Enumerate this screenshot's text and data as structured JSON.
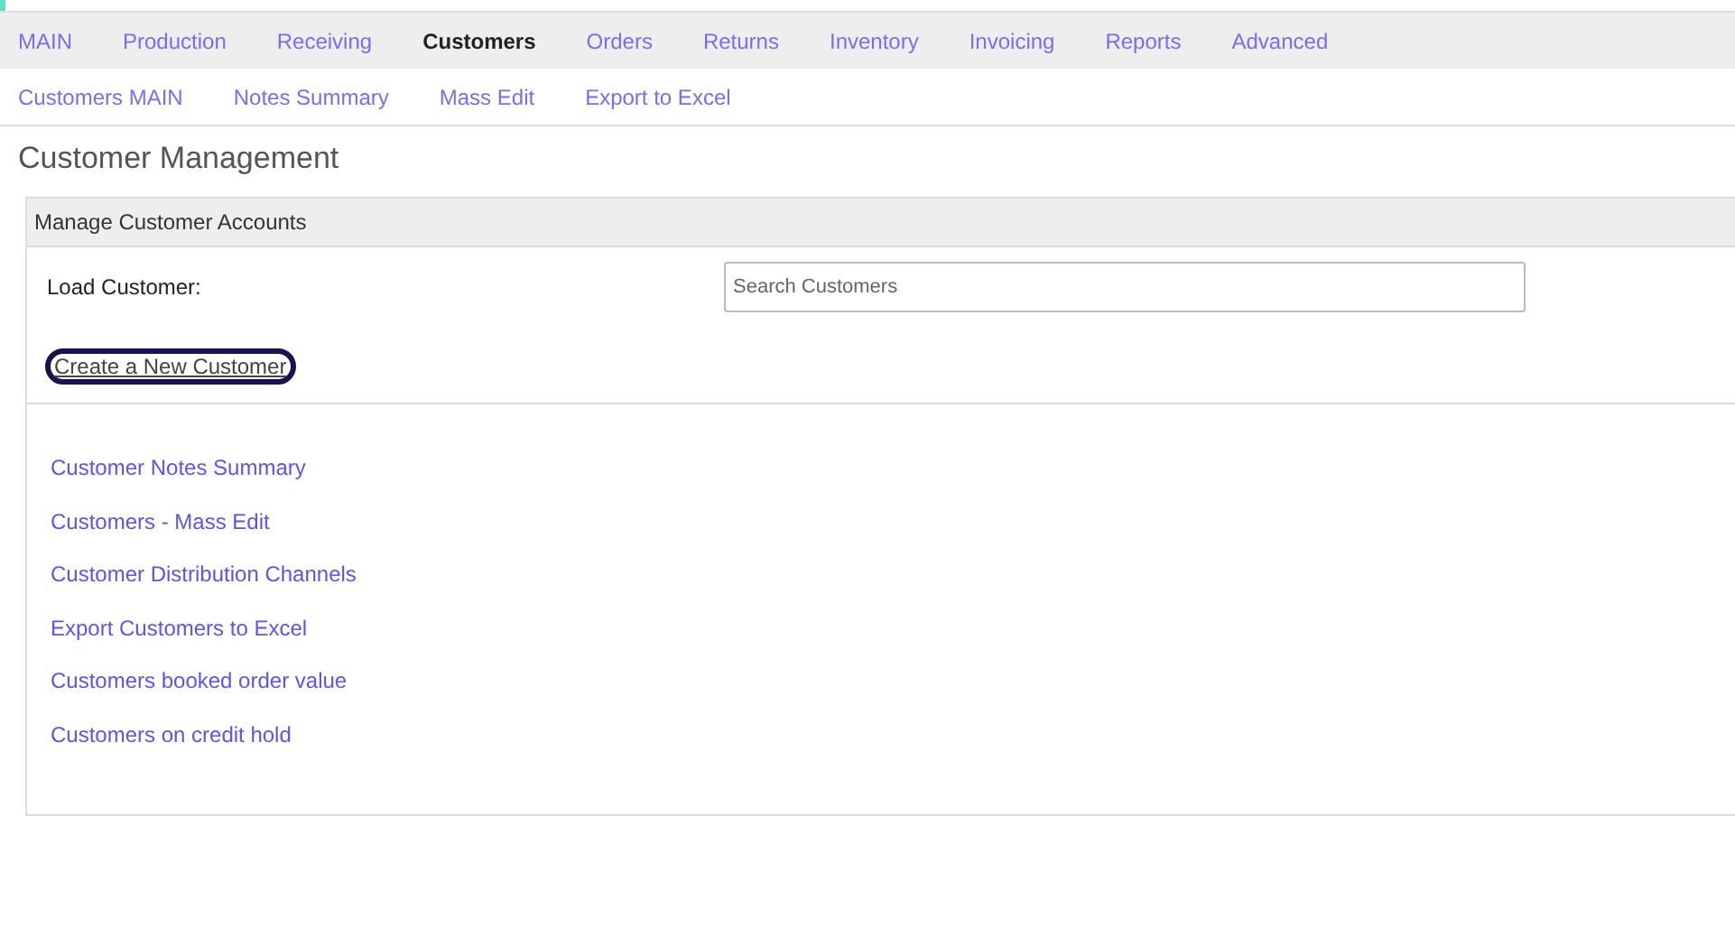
{
  "main_nav": [
    {
      "label": "MAIN",
      "selected": false
    },
    {
      "label": "Production",
      "selected": false
    },
    {
      "label": "Receiving",
      "selected": false
    },
    {
      "label": "Customers",
      "selected": true
    },
    {
      "label": "Orders",
      "selected": false
    },
    {
      "label": "Returns",
      "selected": false
    },
    {
      "label": "Inventory",
      "selected": false
    },
    {
      "label": "Invoicing",
      "selected": false
    },
    {
      "label": "Reports",
      "selected": false
    },
    {
      "label": "Advanced",
      "selected": false
    }
  ],
  "sub_nav": [
    "Customers MAIN",
    "Notes Summary",
    "Mass Edit",
    "Export to Excel"
  ],
  "page_title": "Customer Management",
  "panel": {
    "title": "Manage Customer Accounts",
    "load_label": "Load Customer:",
    "search": {
      "placeholder": "Search Customers"
    },
    "create_button": {
      "label": "Create a New Customer",
      "focused": true
    },
    "links": [
      "Customer Notes Summary",
      "Customers - Mass Edit",
      "Customer Distribution Channels",
      "Export Customers to Excel",
      "Customers booked order value",
      "Customers on credit hold"
    ]
  }
}
